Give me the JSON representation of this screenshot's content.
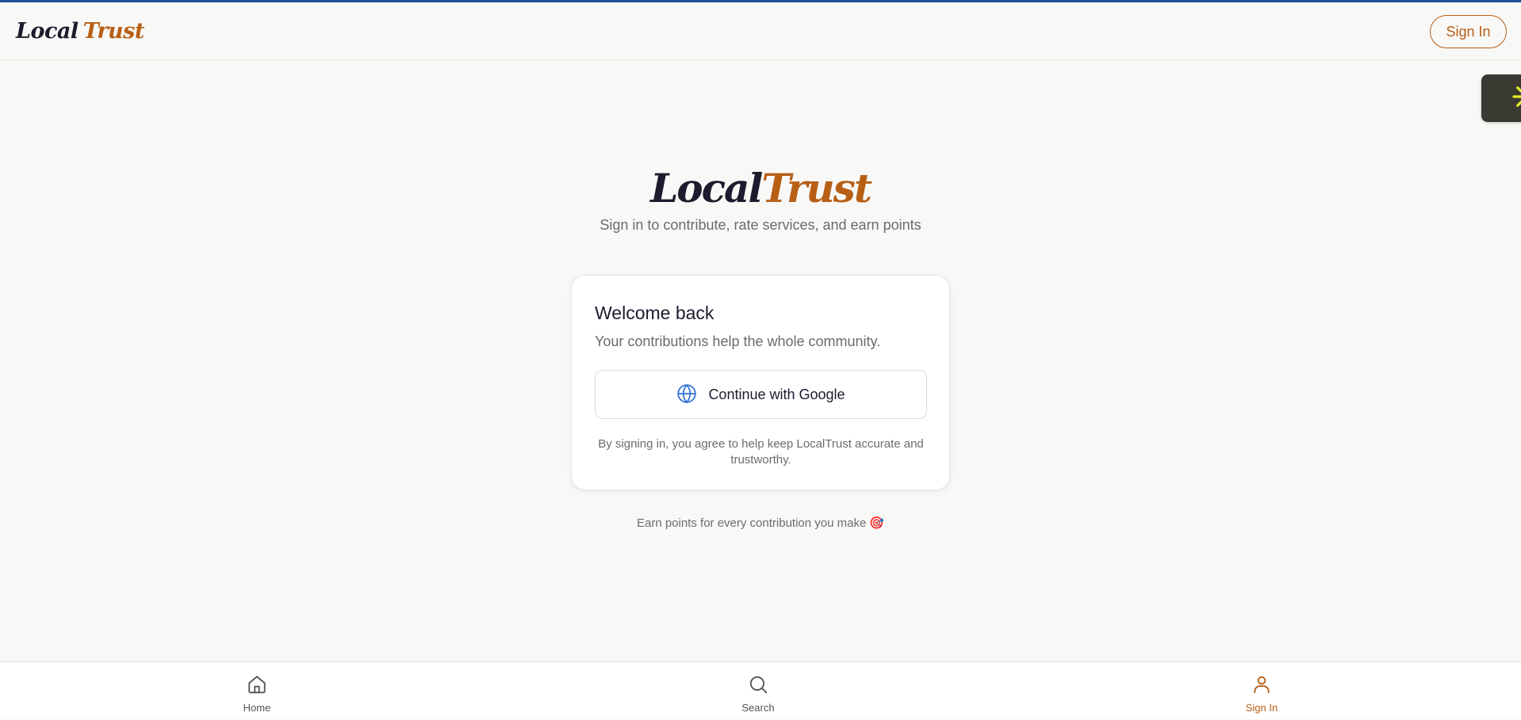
{
  "header": {
    "brand_word1": "Local",
    "brand_word2": "Trust",
    "signin_label": "Sign In"
  },
  "hero": {
    "brand_word1": "Local",
    "brand_word2": "Trust",
    "tagline": "Sign in to contribute, rate services, and earn points"
  },
  "card": {
    "title": "Welcome back",
    "subtitle": "Your contributions help the whole community.",
    "google_button_label": "Continue with Google",
    "google_button_icon": "globe-icon",
    "note": "By signing in, you agree to help keep LocalTrust accurate and trustworthy."
  },
  "footer_note": {
    "text": "Earn points for every contribution you make",
    "emoji": "🎯"
  },
  "bottom_nav": {
    "items": [
      {
        "label": "Home",
        "icon": "home-icon",
        "active": false
      },
      {
        "label": "Search",
        "icon": "search-icon",
        "active": false
      },
      {
        "label": "Sign In",
        "icon": "user-icon",
        "active": true
      }
    ]
  },
  "widget": {
    "icon": "asterisk-icon"
  },
  "colors": {
    "accent": "#b85f16",
    "brand_dark": "#1c1c2e",
    "top_bar": "#1f4f9a",
    "background": "#f8f8f6",
    "google_icon": "#2f6fd6",
    "widget_bg": "#3a3a32",
    "widget_icon": "#e8f02a"
  }
}
